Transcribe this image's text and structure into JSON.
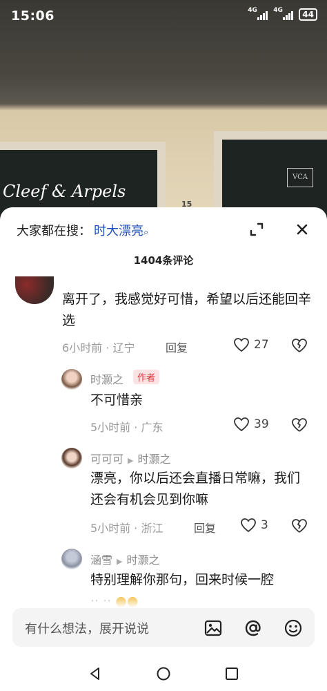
{
  "status": {
    "time": "15:06",
    "net1": "4G",
    "net2": "4G",
    "battery": "44"
  },
  "photo": {
    "brand_text": "Cleef & Arpels",
    "logo_text": "VCA",
    "house_number": "15"
  },
  "sheet": {
    "search_prefix": "大家都在搜：",
    "search_keyword": "时大漂亮",
    "comment_count": "1404条评论"
  },
  "comments": [
    {
      "text": "离开了，我感觉好可惜，希望以后还能回辛选",
      "time_loc": "6小时前 · 辽宁",
      "reply": "回复",
      "likes": "27"
    },
    {
      "name": "时灏之",
      "tag": "作者",
      "text": "不可惜亲",
      "time_loc": "5小时前 · 广东",
      "likes": "39"
    },
    {
      "name": "可可可",
      "reply_to": "时灏之",
      "text": "漂亮，你以后还会直播日常嘛，我们还会有机会见到你嘛",
      "time_loc": "5小时前 · 浙江",
      "reply": "回复",
      "likes": "3"
    },
    {
      "name": "涵雪",
      "reply_to": "时灏之",
      "text": "特别理解你那句，回来时候一腔"
    }
  ],
  "input": {
    "placeholder": "有什么想法，展开说说"
  },
  "colors": {
    "link": "#1e4fb8",
    "author_tag": "#e0313d",
    "author_tag_bg": "#fbe3e3"
  }
}
